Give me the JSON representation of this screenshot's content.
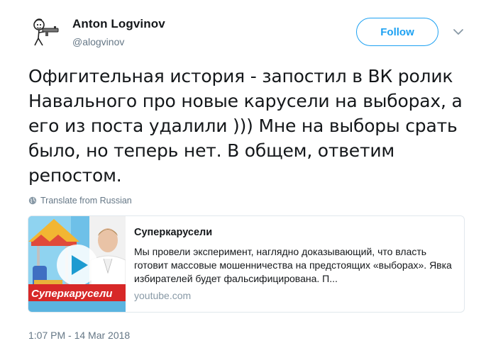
{
  "author": {
    "display_name": "Anton Logvinov",
    "handle": "@alogvinov"
  },
  "actions": {
    "follow_label": "Follow"
  },
  "tweet": {
    "text": "Офигительная история - запостил в ВК ролик Навального про новые карусели на выборах, а его из поста удалили ))) Мне на выборы срать было, но теперь нет. В общем, ответим репостом.",
    "translate_label": "Translate from Russian",
    "timestamp": "1:07 PM - 14 Mar 2018"
  },
  "link_card": {
    "title": "Суперкарусели",
    "description": "Мы провели эксперимент, наглядно доказывающий, что власть готовит массовые мошенничества на предстоящих «выборах». Явка избирателей будет фальсифицирована. П...",
    "domain": "youtube.com",
    "thumbnail_caption": "Суперкарусели"
  },
  "colors": {
    "accent": "#1da1f2",
    "text": "#14171a",
    "secondary": "#657786",
    "border": "#e1e8ed",
    "thumb_banner": "#d72828"
  },
  "icons": {
    "avatar": "hand-drawn-character-with-gun",
    "chevron": "chevron-down-icon",
    "globe": "globe-icon",
    "play": "play-icon"
  }
}
